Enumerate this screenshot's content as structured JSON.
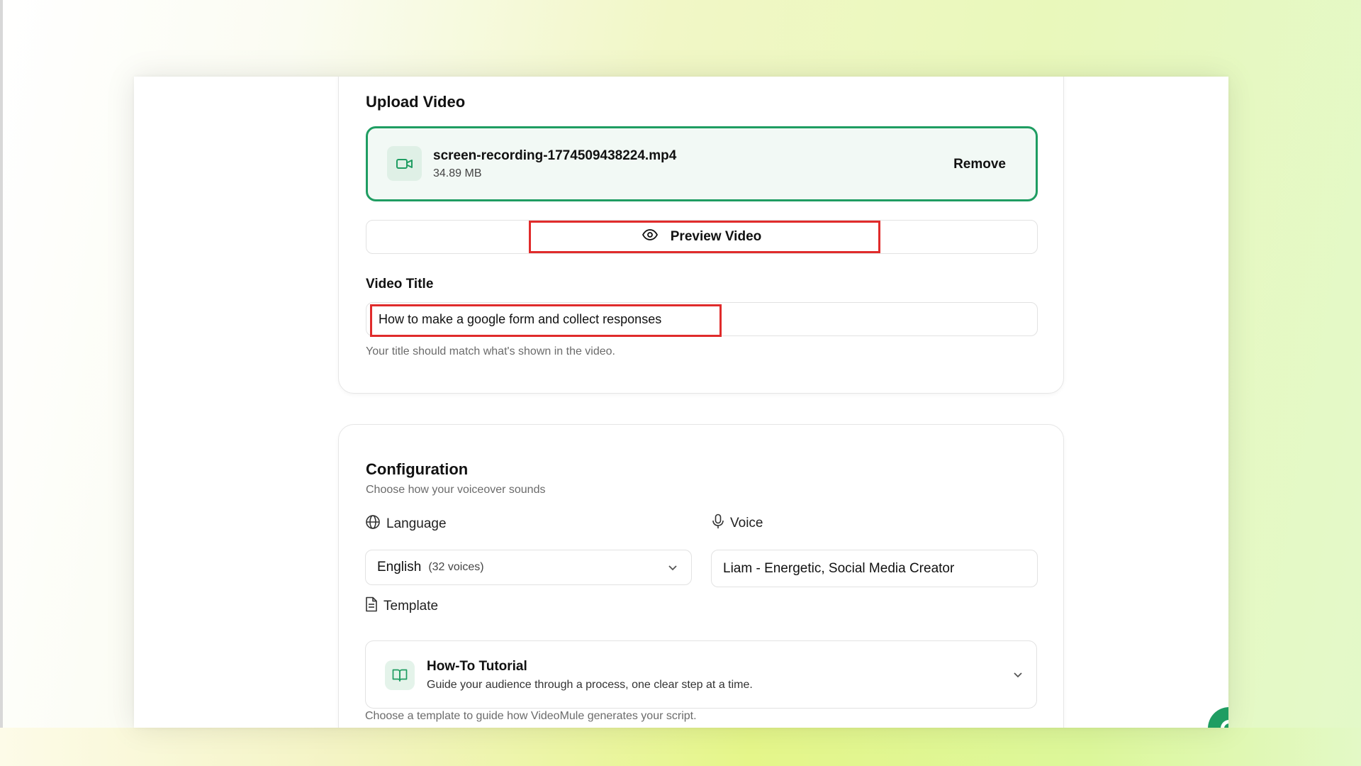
{
  "upload": {
    "title": "Upload Video",
    "file_name": "screen-recording-1774509438224.mp4",
    "file_size": "34.89 MB",
    "remove_label": "Remove",
    "preview_label": "Preview Video",
    "video_title_label": "Video Title",
    "video_title_value": "How to make a google form and collect responses",
    "video_title_hint": "Your title should match what's shown in the video."
  },
  "configuration": {
    "title": "Configuration",
    "subtitle": "Choose how your voiceover sounds",
    "language_label": "Language",
    "language_value": "English",
    "language_count": "(32 voices)",
    "voice_label": "Voice",
    "voice_value": "Liam - Energetic, Social Media Creator",
    "template_label": "Template",
    "template_name": "How-To Tutorial",
    "template_desc": "Guide your audience through a process, one clear step at a time.",
    "template_hint": "Choose a template to guide how VideoMule generates your script."
  },
  "colors": {
    "accent": "#1f9d62",
    "highlight": "#e02b2b"
  },
  "icons": [
    "video-camera-icon",
    "eye-icon",
    "globe-icon",
    "microphone-icon",
    "document-icon",
    "book-icon",
    "chevron-down-icon"
  ]
}
